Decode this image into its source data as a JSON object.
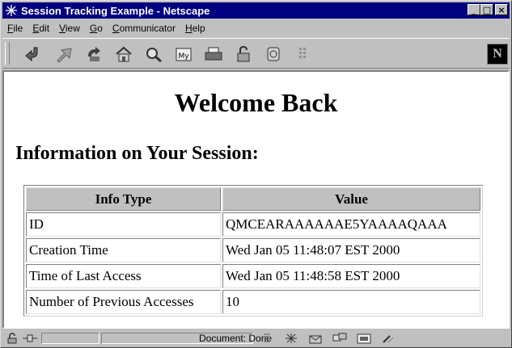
{
  "window": {
    "title": "Session Tracking Example - Netscape",
    "controls": {
      "minimize": "_",
      "maximize": "□",
      "close": "×"
    }
  },
  "menu": {
    "items": [
      {
        "u": "F",
        "rest": "ile"
      },
      {
        "u": "E",
        "rest": "dit"
      },
      {
        "u": "V",
        "rest": "iew"
      },
      {
        "u": "G",
        "rest": "o"
      },
      {
        "u": "C",
        "rest": "ommunicator"
      },
      {
        "u": "H",
        "rest": "elp"
      }
    ]
  },
  "toolbar": {
    "icons": [
      "back-icon",
      "forward-icon",
      "reload-icon",
      "home-icon",
      "search-icon",
      "netscape-guide-icon",
      "print-icon",
      "security-icon",
      "shop-icon",
      "stop-icon"
    ],
    "logo": "N"
  },
  "page": {
    "title": "Welcome Back",
    "section_title": "Information on Your Session:",
    "table": {
      "headers": [
        "Info Type",
        "Value"
      ],
      "rows": [
        [
          "ID",
          "QMCEARAAAAAAE5YAAAAQAAA"
        ],
        [
          "Creation Time",
          "Wed Jan 05 11:48:07 EST 2000"
        ],
        [
          "Time of Last Access",
          "Wed Jan 05 11:48:58 EST 2000"
        ],
        [
          "Number of Previous Accesses",
          "10"
        ]
      ]
    }
  },
  "status": {
    "text": "Document: Done"
  },
  "colors": {
    "titlebar": "#000080",
    "chrome": "#c0c0c0",
    "table_header": "#c0c0c0"
  }
}
